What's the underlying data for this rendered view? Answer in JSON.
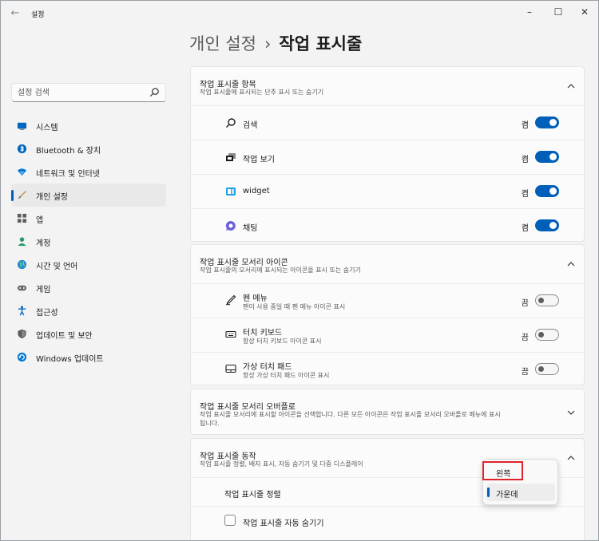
{
  "window": {
    "app_title": "설정",
    "back_glyph": "←",
    "minimize_glyph": "–",
    "maximize_glyph": "☐",
    "close_glyph": "✕"
  },
  "header": {
    "parent": "개인 설정",
    "separator": "›",
    "current": "작업 표시줄"
  },
  "search": {
    "placeholder": "설정 검색"
  },
  "sidebar": {
    "items": [
      {
        "label": "시스템",
        "icon": "monitor-icon",
        "active": false
      },
      {
        "label": "Bluetooth & 장치",
        "icon": "bluetooth-icon",
        "active": false
      },
      {
        "label": "네트워크 및 인터넷",
        "icon": "wifi-icon",
        "active": false
      },
      {
        "label": "개인 설정",
        "icon": "brush-icon",
        "active": true
      },
      {
        "label": "앱",
        "icon": "apps-icon",
        "active": false
      },
      {
        "label": "계정",
        "icon": "person-icon",
        "active": false
      },
      {
        "label": "시간 및 언어",
        "icon": "globe-clock-icon",
        "active": false
      },
      {
        "label": "게임",
        "icon": "gamepad-icon",
        "active": false
      },
      {
        "label": "접근성",
        "icon": "accessibility-icon",
        "active": false
      },
      {
        "label": "업데이트 및 보안",
        "icon": "shield-icon",
        "active": false
      },
      {
        "label": "Windows 업데이트",
        "icon": "update-icon",
        "active": false
      }
    ]
  },
  "taskbar_items": {
    "title": "작업 표시줄 항목",
    "subtitle": "작업 표시줄에 표시되는 단추 표시 또는 숨기기",
    "rows": [
      {
        "label": "검색",
        "state": "켬",
        "on": true,
        "icon": "search-icon"
      },
      {
        "label": "작업 보기",
        "state": "켬",
        "on": true,
        "icon": "task-view-icon"
      },
      {
        "label": "widget",
        "state": "켬",
        "on": true,
        "icon": "widget-icon"
      },
      {
        "label": "채팅",
        "state": "켬",
        "on": true,
        "icon": "chat-icon"
      }
    ]
  },
  "corner_icons": {
    "title": "작업 표시줄 모서리 아이콘",
    "subtitle": "작업 표시줄의 모서리에 표시되는 아이콘을 표시 또는 숨기기",
    "rows": [
      {
        "label": "펜 메뉴",
        "sub": "펜이 사용 중일 때 펜 메뉴 아이콘 표시",
        "state": "끔",
        "on": false,
        "icon": "pen-icon"
      },
      {
        "label": "터치 키보드",
        "sub": "항상 터치 키보드 아이콘 표시",
        "state": "끔",
        "on": false,
        "icon": "keyboard-icon"
      },
      {
        "label": "가상 터치 패드",
        "sub": "항상 가상 터치 패드 아이콘 표시",
        "state": "끔",
        "on": false,
        "icon": "touchpad-icon"
      }
    ]
  },
  "overflow": {
    "title": "작업 표시줄 모서리 오버플로",
    "subtitle_line1": "작업 표시줄 모서리에 표시할 아이콘을 선택합니다. 다른 모든 아이콘은 작업 표시줄 모서리 오버플로 메뉴에 표시",
    "subtitle_line2": "됩니다."
  },
  "behaviors": {
    "title": "작업 표시줄 동작",
    "subtitle": "작업 표시줄 정렬, 배지 표시, 자동 숨기기 및 다중 디스플레이",
    "alignment_label": "작업 표시줄 정렬",
    "autohide_label": "작업 표시줄 자동 숨기기"
  },
  "alignment_dropdown": {
    "options": [
      {
        "label": "왼쪽",
        "selected": false
      },
      {
        "label": "가운데",
        "selected": true
      }
    ],
    "highlighted": "왼쪽"
  },
  "colors": {
    "accent": "#005fb8",
    "highlight": "#e0222c"
  }
}
